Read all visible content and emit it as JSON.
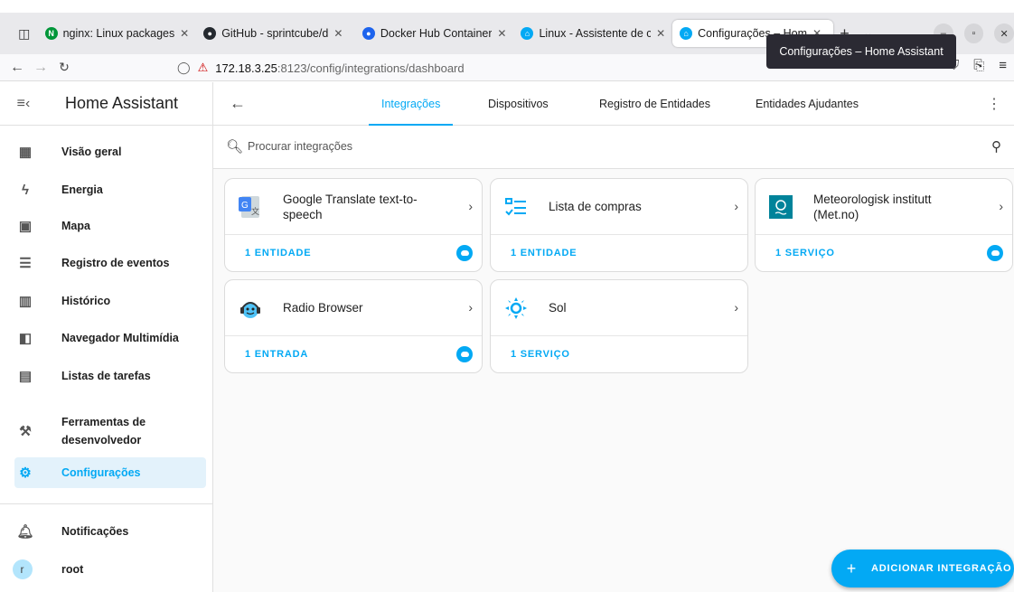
{
  "browser": {
    "tabs": [
      {
        "title": "nginx: Linux packages",
        "favicon": "nginx-icon",
        "color": "#009639"
      },
      {
        "title": "GitHub - sprintcube/d",
        "favicon": "github-icon",
        "color": "#24292f"
      },
      {
        "title": "Docker Hub Container",
        "favicon": "docker-icon",
        "color": "#1d63ed"
      },
      {
        "title": "Linux - Assistente de c",
        "favicon": "home-assistant-icon",
        "color": "#03a9f4"
      },
      {
        "title": "Configurações – Hom",
        "favicon": "home-assistant-icon",
        "color": "#03a9f4"
      }
    ],
    "tooltip": "Configurações – Home Assistant",
    "url_host": "172.18.3.25",
    "url_path": ":8123/config/integrations/dashboard"
  },
  "sidebar": {
    "title": "Home Assistant",
    "items": [
      {
        "label": "Visão geral",
        "icon": "dashboard-icon"
      },
      {
        "label": "Energia",
        "icon": "lightning-icon"
      },
      {
        "label": "Mapa",
        "icon": "map-icon"
      },
      {
        "label": "Registro de eventos",
        "icon": "list-icon"
      },
      {
        "label": "Histórico",
        "icon": "chart-icon"
      },
      {
        "label": "Navegador Multimídia",
        "icon": "media-icon"
      },
      {
        "label": "Listas de tarefas",
        "icon": "clipboard-icon"
      },
      {
        "label": "Ferramentas de desenvolvedor",
        "icon": "hammer-icon"
      },
      {
        "label": "Configurações",
        "icon": "cog-icon"
      },
      {
        "label": "Notificações",
        "icon": "bell-icon"
      },
      {
        "label": "root",
        "icon": "avatar",
        "avatar_letter": "r"
      }
    ]
  },
  "topnav": {
    "tabs": [
      "Integrações",
      "Dispositivos",
      "Registro de Entidades",
      "Entidades Ajudantes"
    ],
    "active": 0
  },
  "search": {
    "placeholder": "Procurar integrações"
  },
  "integrations": [
    {
      "name": "Google Translate text-to-speech",
      "link": "1 ENTIDADE",
      "cloud": true
    },
    {
      "name": "Lista de compras",
      "link": "1 ENTIDADE",
      "cloud": false
    },
    {
      "name": "Meteorologisk institutt (Met.no)",
      "link": "1 SERVIÇO",
      "cloud": true
    },
    {
      "name": "Radio Browser",
      "link": "1 ENTRADA",
      "cloud": true
    },
    {
      "name": "Sol",
      "link": "1 SERVIÇO",
      "cloud": false
    }
  ],
  "fab": {
    "label": "ADICIONAR INTEGRAÇÃO"
  },
  "colors": {
    "accent": "#03a9f4"
  }
}
